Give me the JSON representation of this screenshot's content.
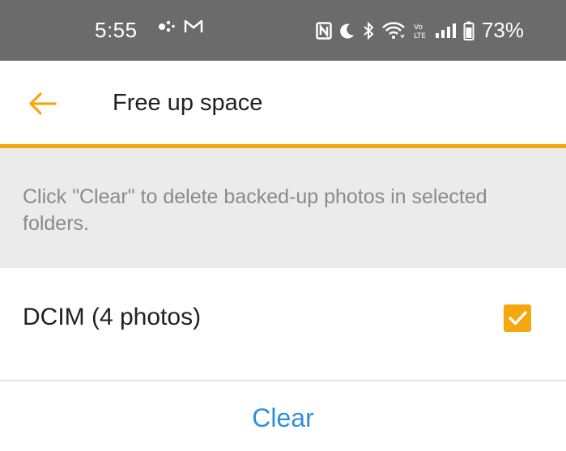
{
  "status_bar": {
    "time": "5:55",
    "battery_percent": "73%",
    "left_icons": [
      "assistant-dots-icon",
      "gmail-icon"
    ],
    "right_icons": [
      "nfc-icon",
      "do-not-disturb-moon-icon",
      "bluetooth-icon",
      "wifi-icon",
      "volte-icon",
      "signal-icon",
      "battery-icon"
    ]
  },
  "app_bar": {
    "title": "Free up space",
    "back_icon": "arrow-left-icon"
  },
  "info": {
    "text": "Click \"Clear\" to delete backed-up photos in selected folders."
  },
  "folders": [
    {
      "label": "DCIM (4 photos)",
      "checked": true
    }
  ],
  "actions": {
    "clear_label": "Clear"
  },
  "colors": {
    "accent": "#f4a70f",
    "link_blue": "#2f8fdc",
    "status_bar": "#6b6b6b",
    "banner_bg": "#ebebeb"
  }
}
